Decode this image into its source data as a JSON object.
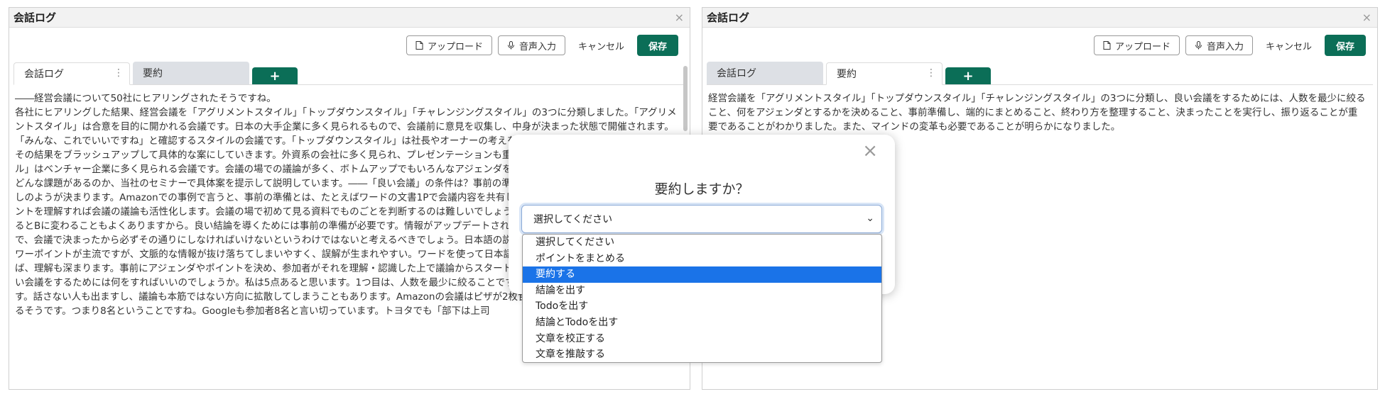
{
  "left_panel": {
    "title": "会話ログ",
    "close": "×",
    "toolbar": {
      "upload_label": "アップロード",
      "voice_label": "音声入力",
      "cancel_label": "キャンセル",
      "save_label": "保存"
    },
    "tabs": [
      {
        "label": "会話ログ",
        "active": true,
        "menu": "⋮"
      },
      {
        "label": "要約",
        "active": false
      }
    ],
    "add_tab": "+",
    "content": "――経営会議について50社にヒアリングされたそうですね。\n各社にヒアリングした結果、経営会議を「アグリメントスタイル」「トップダウンスタイル」「チャレンジングスタイル」の3つに分類しました。「アグリメントスタイル」は合意を目的に開かれる会議です。日本の大手企業に多く見られるもので、会議前に意見を収集し、中身が決まった状態で開催されます。「みんな、これでいいですね」と確認するスタイルの会議です。「トップダウンスタイル」は社長やオーナーの考えをベースに参加者で議論する会議です。その結果をブラッシュアップして具体的な案にしていきます。外資系の会社に多く見られ、プレゼンテーションも重視されます。「チャレンジングスタイル」はベンチャー企業に多く見られる会議です。会議の場での議論が多く、ボトムアップでもいろんなアジェンダを提案できます。それぞれのスタイルにどんな課題があるのか、当社のセミナーで具体案を提示して説明しています。――「良い会議」の条件は？事前の準備が大事ですね。準備で会議の良し悪しのようが決まります。Amazonでの事例で言うと、事前の準備とは、たとえばワードの文書1Pで会議内容を共有しておくことです。事前に参加者がポイントを理解すれば会議の議論も活性化します。会議の場で初めて見る資料でものごとを判断するのは難しいでしょう。最初はAでだと思っていても熟慮するとBに変わることもよくありますから。良い結論を導くためには事前の準備が必要です。情報がアップデートされれば結論も変わるかもしれませんので、会議で決まったから必ずその通りにしなければいけないというわけではないと考えるべきでしょう。日本語の説明文をつけることも大切です。今はパワーポイントが主流ですが、文脈的な情報が抜け落ちてしまいやすく、誤解が生まれやすい。ワードを使って日本語で書き、細かい接続詞なども挿入すれば、理解も深まります。事前にアジェンダやポイントを決め、参加者がそれを理解・認識した上で議論からスタートさせるのが望ましい会議です。――良い会議をするためには何をすればいいのでしょうか。私は5点あると思います。1つ目は、人数を最少に絞ることです。人数が多すぎると会議の質が落ちます。話さない人も出ますし、議論も本筋ではない方向に拡散してしまうこともあります。Amazonの会議はピザが2枚食べられる人数に参加者を絞っているそうです。つまり8名ということですね。Googleも参加者8名と言い切っています。トヨタでも「部下は上司"
  },
  "right_panel": {
    "title": "会話ログ",
    "close": "×",
    "toolbar": {
      "upload_label": "アップロード",
      "voice_label": "音声入力",
      "cancel_label": "キャンセル",
      "save_label": "保存"
    },
    "tabs": [
      {
        "label": "会話ログ",
        "active": false
      },
      {
        "label": "要約",
        "active": true,
        "menu": "⋮"
      }
    ],
    "add_tab": "+",
    "content": "経営会議を「アグリメントスタイル」「トップダウンスタイル」「チャレンジングスタイル」の3つに分類し、良い会議をするためには、人数を最少に絞ること、何をアジェンダとするかを決めること、事前準備し、端的にまとめること、終わり方を整理すること、決まったことを実行し、振り返ることが重要であることがわかりました。また、マインドの変革も必要であることが明らかになりました。"
  },
  "modal": {
    "close": "×",
    "title": "要約しますか？",
    "select_value": "選択してください",
    "caret": "⌄",
    "options": [
      {
        "label": "選択してください",
        "selected": false
      },
      {
        "label": "ポイントをまとめる",
        "selected": false
      },
      {
        "label": "要約する",
        "selected": true
      },
      {
        "label": "結論を出す",
        "selected": false
      },
      {
        "label": "Todoを出す",
        "selected": false
      },
      {
        "label": "結論とTodoを出す",
        "selected": false
      },
      {
        "label": "文章を校正する",
        "selected": false
      },
      {
        "label": "文章を推敲する",
        "selected": false
      }
    ]
  },
  "colors": {
    "accent": "#0b6e57",
    "dropdown_highlight": "#1a73e8"
  }
}
